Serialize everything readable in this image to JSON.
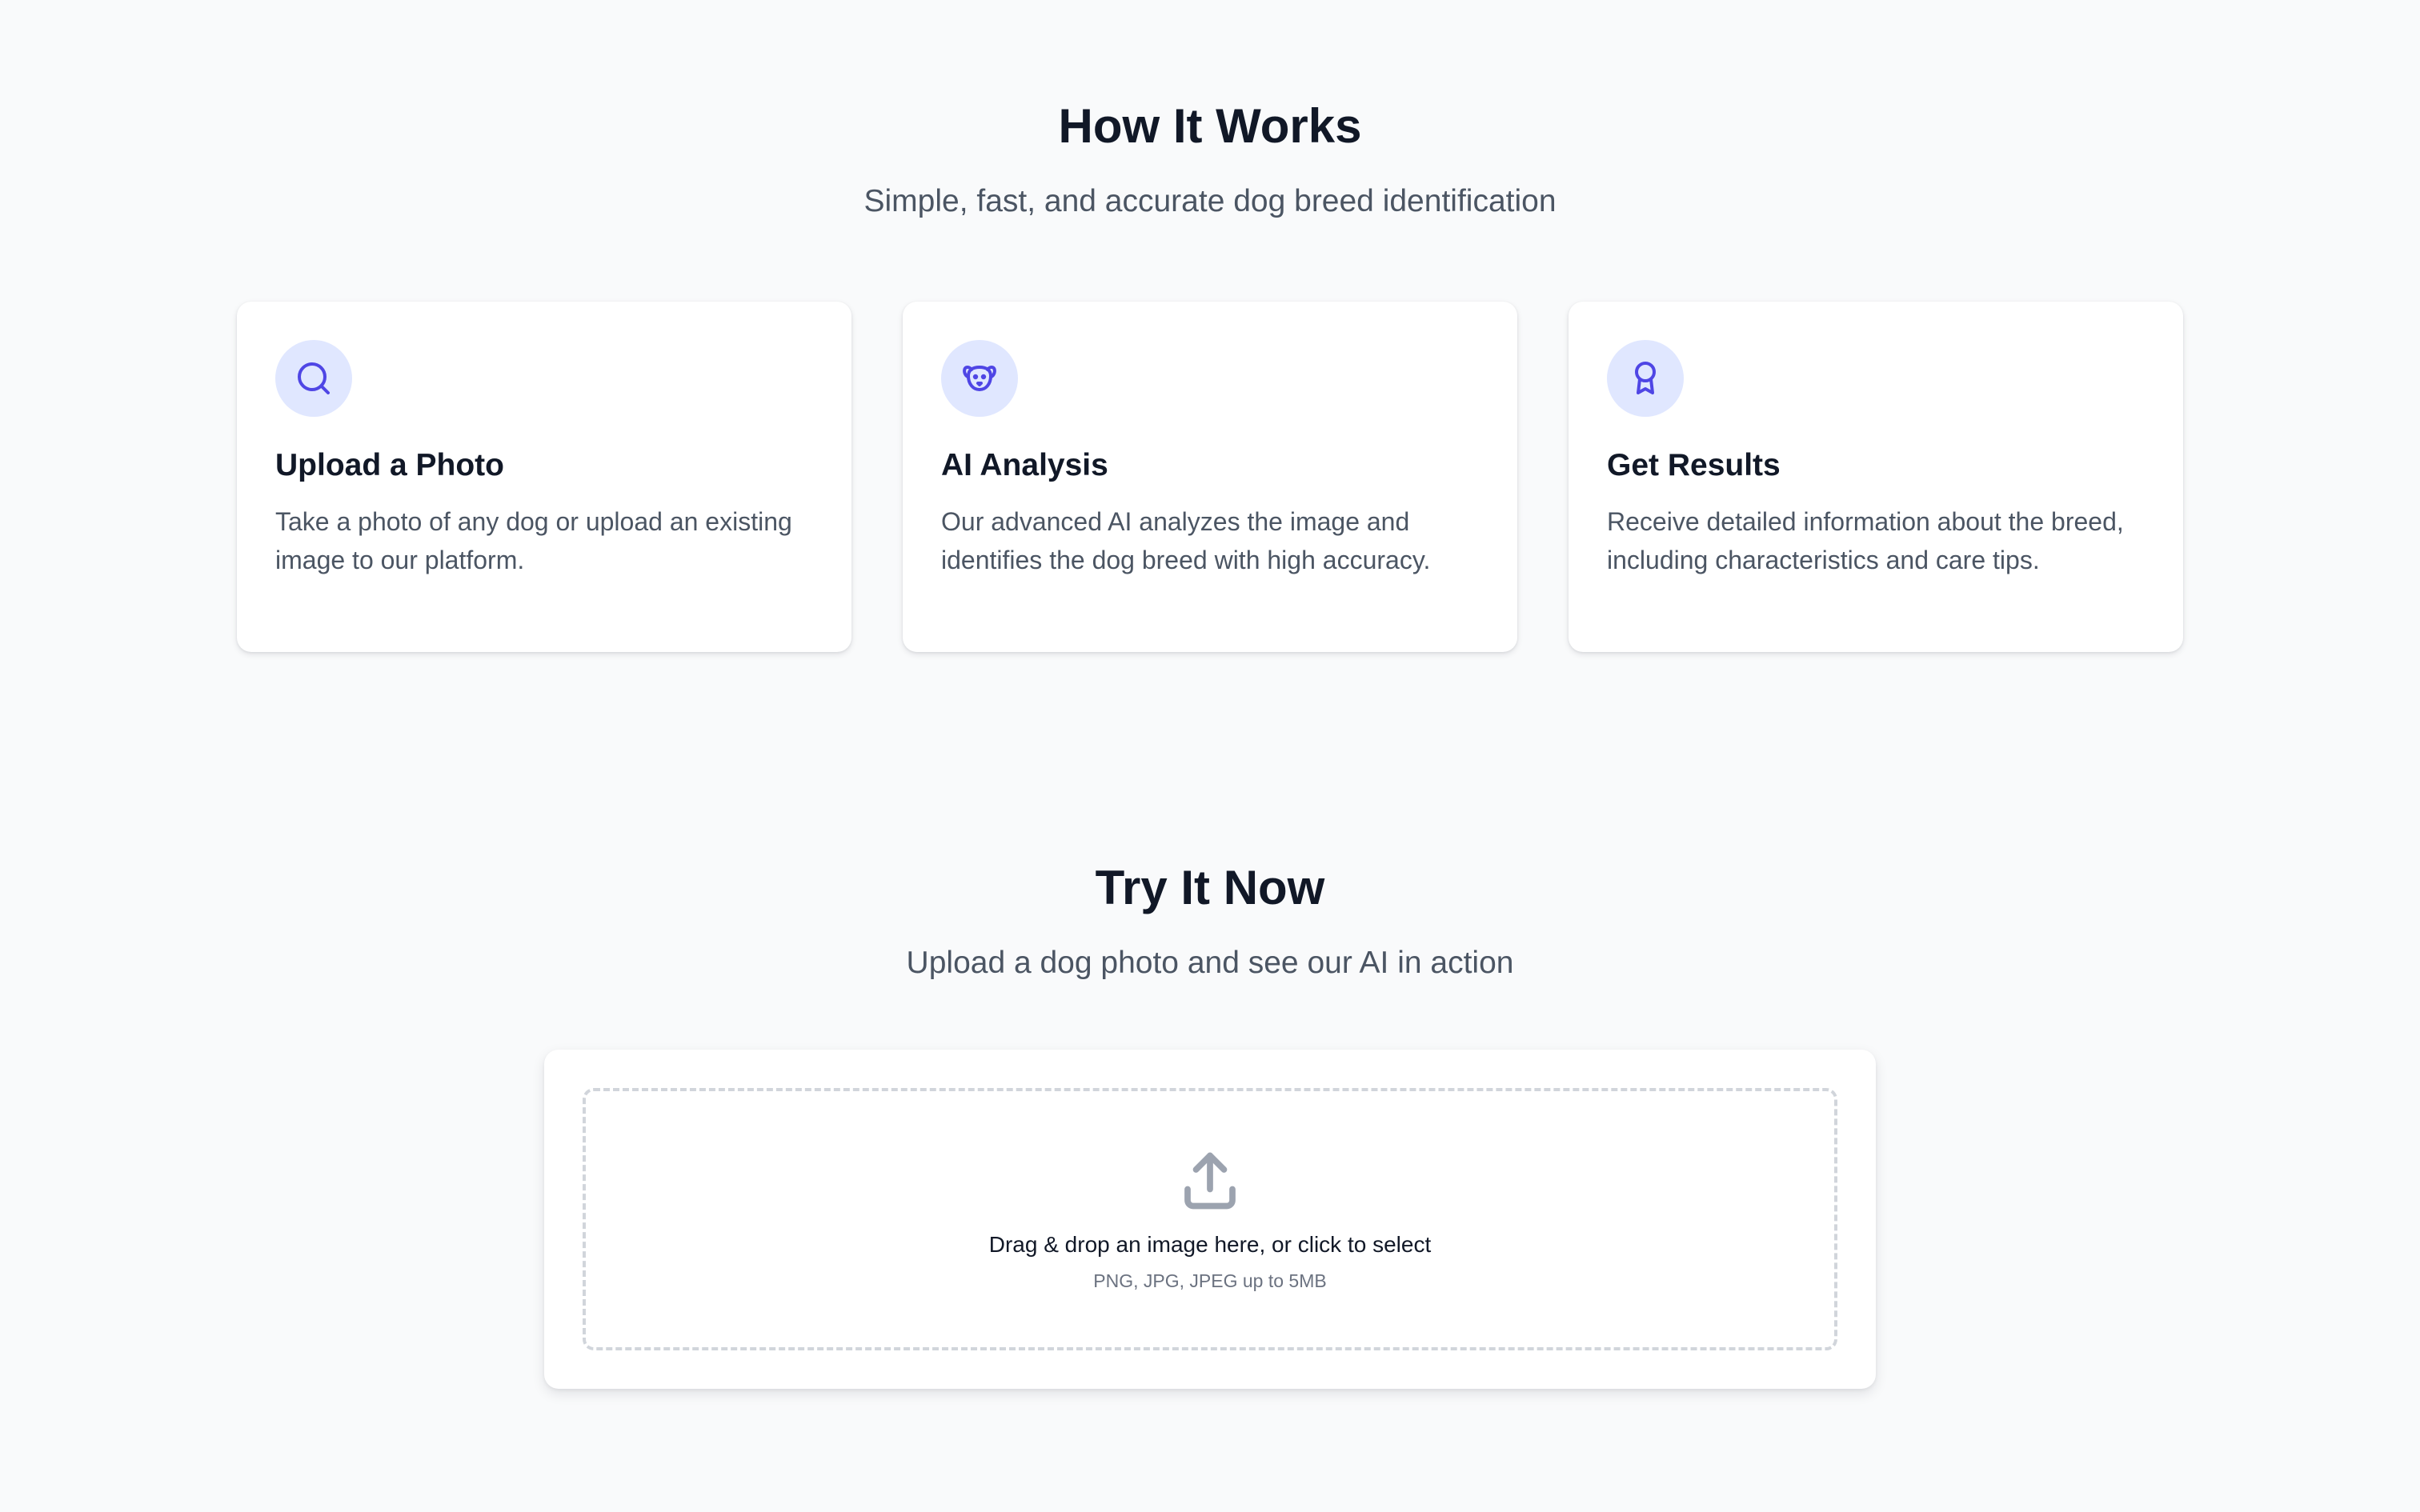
{
  "how_it_works": {
    "title": "How It Works",
    "subtitle": "Simple, fast, and accurate dog breed identification",
    "cards": [
      {
        "icon": "search-icon",
        "title": "Upload a Photo",
        "description": "Take a photo of any dog or upload an existing image to our platform."
      },
      {
        "icon": "dog-icon",
        "title": "AI Analysis",
        "description": "Our advanced AI analyzes the image and identifies the dog breed with high accuracy."
      },
      {
        "icon": "award-icon",
        "title": "Get Results",
        "description": "Receive detailed information about the breed, including characteristics and care tips."
      }
    ]
  },
  "try_it_now": {
    "title": "Try It Now",
    "subtitle": "Upload a dog photo and see our AI in action",
    "dropzone": {
      "icon": "upload-icon",
      "label": "Drag & drop an image here, or click to select",
      "hint": "PNG, JPG, JPEG up to 5MB"
    }
  },
  "colors": {
    "background": "#f9fafb",
    "accent": "#4f46e5",
    "icon_bg": "#e0e7ff",
    "heading": "#111827",
    "body_text": "#4b5563"
  }
}
